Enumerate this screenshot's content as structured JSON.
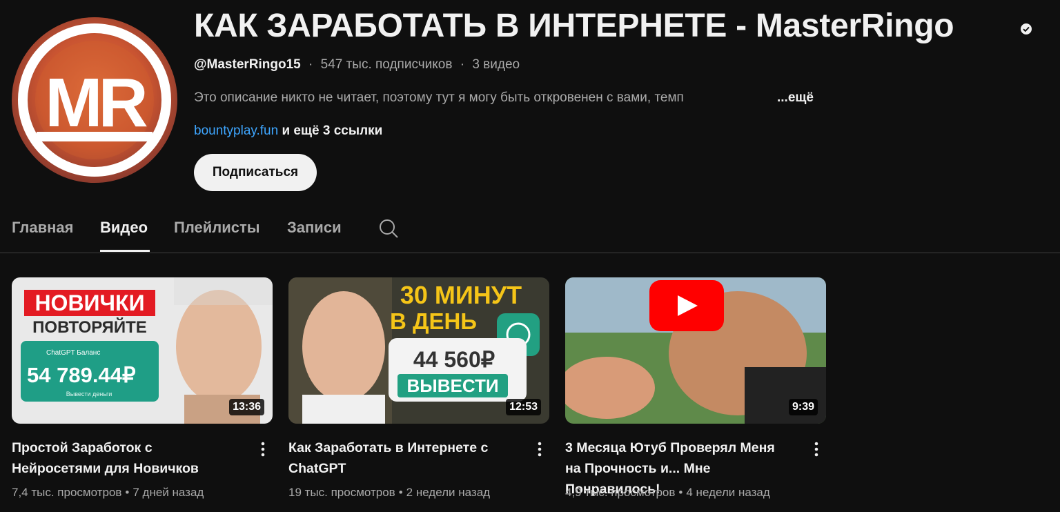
{
  "channel": {
    "avatar_letters": "MR",
    "title": "КАК ЗАРАБОТАТЬ В ИНТЕРНЕТЕ - MasterRingo",
    "handle": "@MasterRingo15",
    "subscribers": "547 тыс. подписчиков",
    "video_count": "3 видео",
    "separator": "·",
    "description": "Это описание никто не читает, поэтому тут я могу быть откровенен с вами, темп",
    "description_more": "...ещё",
    "link": "bountyplay.fun",
    "more_links": " и ещё 3 ссылки",
    "subscribe_label": "Подписаться",
    "verified_icon": "verified-check-icon"
  },
  "tabs": [
    {
      "label": "Главная",
      "active": false
    },
    {
      "label": "Видео",
      "active": true
    },
    {
      "label": "Плейлисты",
      "active": false
    },
    {
      "label": "Записи",
      "active": false
    }
  ],
  "tabs_search_icon": "search-icon",
  "videos": [
    {
      "title": "Простой Заработок с Нейросетями для Новичков",
      "views": "7,4 тыс. просмотров",
      "age": "7 дней назад",
      "duration": "13:36",
      "thumb_text": {
        "line1": "НОВИЧКИ",
        "line2": "ПОВТОРЯЙТЕ",
        "card_label": "ChatGPT Баланс",
        "amount": "54 789.44₽",
        "card_sub": "Вывести деньги"
      }
    },
    {
      "title": "Как Заработать в Интернете с ChatGPT",
      "views": "19 тыс. просмотров",
      "age": "2 недели назад",
      "duration": "12:53",
      "thumb_text": {
        "line1": "30 МИНУТ",
        "line2": "В ДЕНЬ",
        "amount": "44 560₽",
        "button": "ВЫВЕСТИ"
      }
    },
    {
      "title": "3 Месяца Ютуб Проверял Меня на Прочность и... Мне Понравилось!",
      "views": "4,9 тыс. просмотров",
      "age": "4 недели назад",
      "duration": "9:39"
    }
  ],
  "meta_separator": "•",
  "colors": {
    "background": "#0f0f0f",
    "text_primary": "#f1f1f1",
    "text_secondary": "#aaaaaa",
    "link": "#3ea6ff",
    "youtube_red": "#ff0000"
  }
}
